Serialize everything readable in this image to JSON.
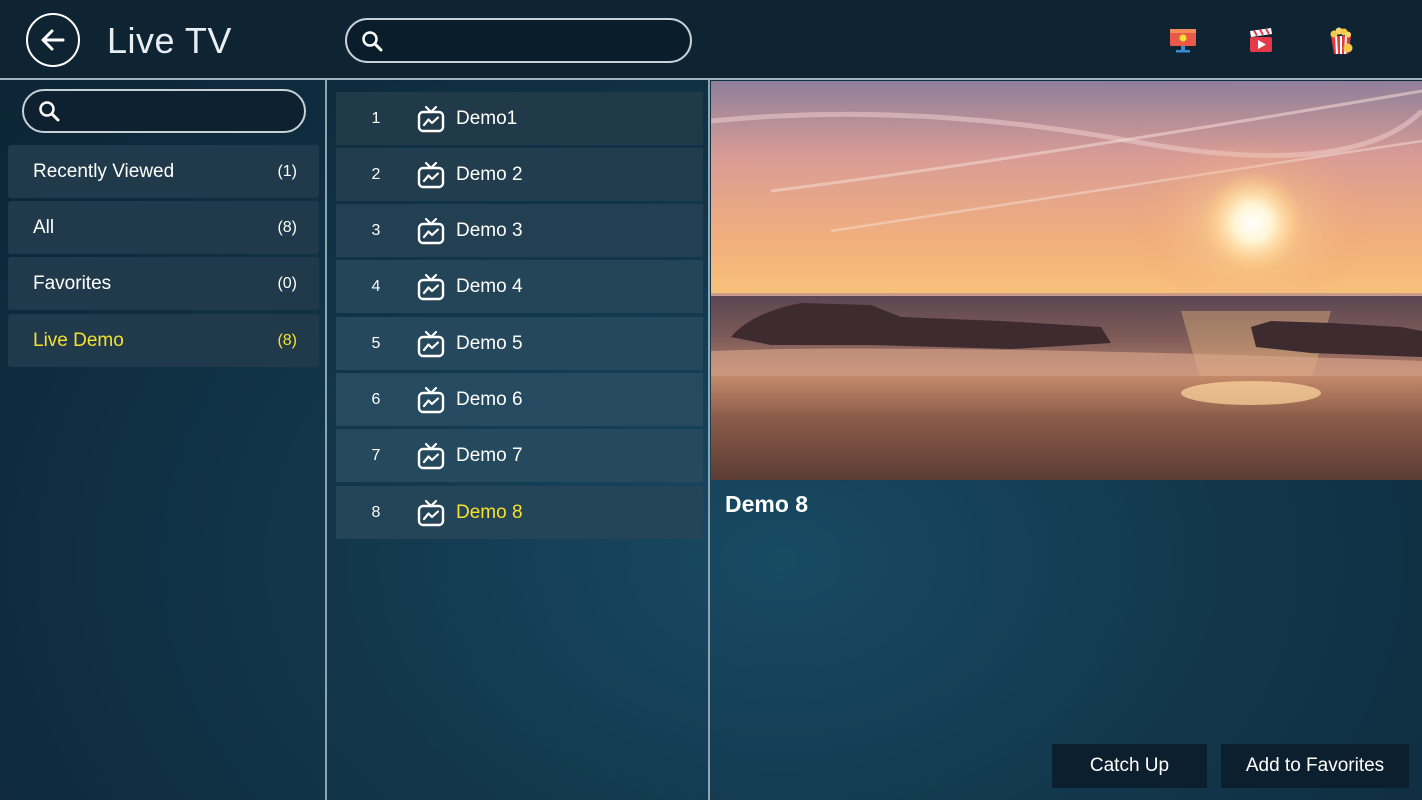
{
  "header": {
    "title": "Live TV",
    "search_placeholder": "",
    "icons": [
      "live-tv-icon",
      "movies-icon",
      "series-icon"
    ]
  },
  "sidebar": {
    "search_placeholder": "",
    "categories": [
      {
        "label": "Recently Viewed",
        "count": "(1)"
      },
      {
        "label": "All",
        "count": "(8)"
      },
      {
        "label": "Favorites",
        "count": "(0)"
      },
      {
        "label": "Live Demo",
        "count": "(8)",
        "selected": true
      }
    ]
  },
  "channels": [
    {
      "number": "1",
      "name": "Demo1"
    },
    {
      "number": "2",
      "name": "Demo 2"
    },
    {
      "number": "3",
      "name": "Demo 3"
    },
    {
      "number": "4",
      "name": "Demo 4"
    },
    {
      "number": "5",
      "name": "Demo 5"
    },
    {
      "number": "6",
      "name": "Demo 6"
    },
    {
      "number": "7",
      "name": "Demo 7"
    },
    {
      "number": "8",
      "name": "Demo 8",
      "selected": true
    }
  ],
  "player": {
    "now_playing": "Demo 8"
  },
  "actions": {
    "catch_up": "Catch Up",
    "add_favorites": "Add to Favorites"
  },
  "colors": {
    "accent": "#f6e12d",
    "panel": "#203a4b"
  }
}
